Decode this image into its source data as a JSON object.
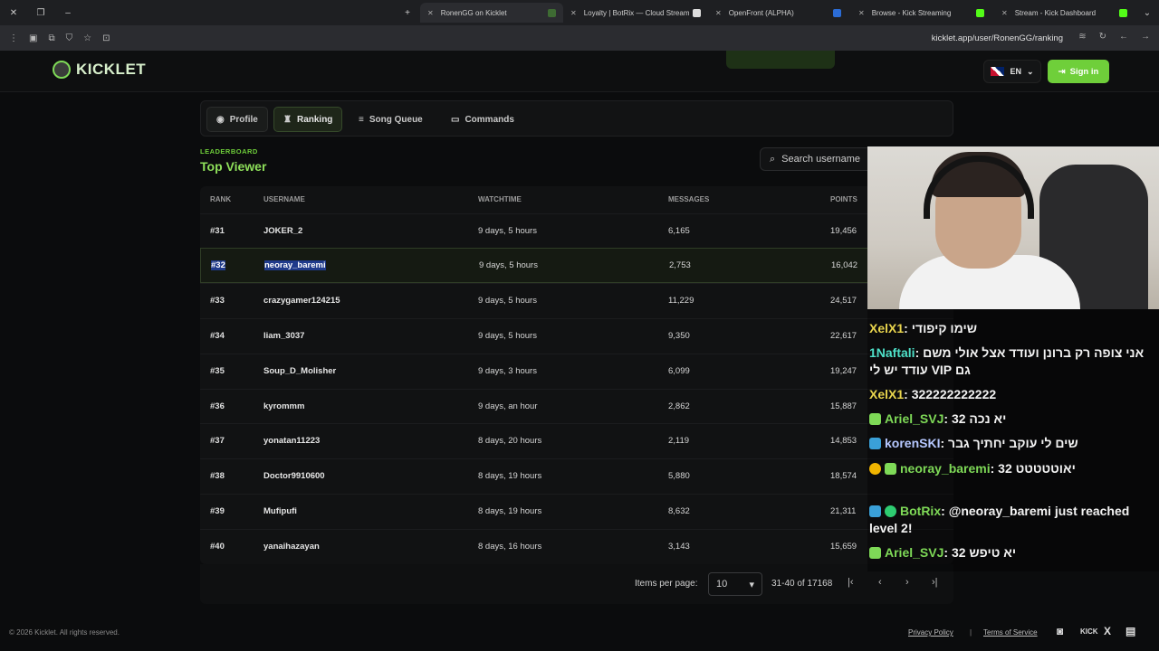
{
  "browser": {
    "tabs": [
      {
        "title": "RonenGG on Kicklet",
        "active": true
      },
      {
        "title": "Loyalty | BotRix — Cloud Stream",
        "active": false
      },
      {
        "title": "OpenFront (ALPHA)",
        "active": false
      },
      {
        "title": "Browse - Kick Streaming",
        "active": false
      },
      {
        "title": "Stream - Kick Dashboard",
        "active": false
      }
    ],
    "url": "kicklet.app/user/RonenGG/ranking"
  },
  "header": {
    "logo_text": "KICKLET",
    "language": "EN",
    "signin_label": "Sign in",
    "accent": "#6fcf3a"
  },
  "nav": {
    "items": [
      {
        "label": "Profile",
        "icon": "user-circle-icon"
      },
      {
        "label": "Ranking",
        "icon": "trophy-icon"
      },
      {
        "label": "Song Queue",
        "icon": "music-list-icon"
      },
      {
        "label": "Commands",
        "icon": "terminal-icon"
      }
    ]
  },
  "leaderboard": {
    "label": "LEADERBOARD",
    "title": "Top Viewer",
    "search_placeholder": "Search username",
    "columns": [
      "RANK",
      "USERNAME",
      "WATCHTIME",
      "MESSAGES",
      "POINTS"
    ],
    "rows": [
      {
        "rank": "#31",
        "username": "JOKER_2",
        "watchtime": "9 days, 5 hours",
        "messages": "6,165",
        "points": "19,456"
      },
      {
        "rank": "#32",
        "username": "neoray_baremi",
        "watchtime": "9 days, 5 hours",
        "messages": "2,753",
        "points": "16,042"
      },
      {
        "rank": "#33",
        "username": "crazygamer124215",
        "watchtime": "9 days, 5 hours",
        "messages": "11,229",
        "points": "24,517"
      },
      {
        "rank": "#34",
        "username": "liam_3037",
        "watchtime": "9 days, 5 hours",
        "messages": "9,350",
        "points": "22,617"
      },
      {
        "rank": "#35",
        "username": "Soup_D_Molisher",
        "watchtime": "9 days, 3 hours",
        "messages": "6,099",
        "points": "19,247"
      },
      {
        "rank": "#36",
        "username": "kyrommm",
        "watchtime": "9 days, an hour",
        "messages": "2,862",
        "points": "15,887"
      },
      {
        "rank": "#37",
        "username": "yonatan11223",
        "watchtime": "8 days, 20 hours",
        "messages": "2,119",
        "points": "14,853"
      },
      {
        "rank": "#38",
        "username": "Doctor9910600",
        "watchtime": "8 days, 19 hours",
        "messages": "5,880",
        "points": "18,574"
      },
      {
        "rank": "#39",
        "username": "Mufipufi",
        "watchtime": "8 days, 19 hours",
        "messages": "8,632",
        "points": "21,311"
      },
      {
        "rank": "#40",
        "username": "yanaihazayan",
        "watchtime": "8 days, 16 hours",
        "messages": "3,143",
        "points": "15,659"
      }
    ]
  },
  "pagination": {
    "items_per_page_label": "Items per page:",
    "items_per_page": "10",
    "range": "31-40 of 17168"
  },
  "footer": {
    "copyright": "© 2026 Kicklet. All rights reserved.",
    "privacy": "Privacy Policy",
    "separator": "|",
    "terms": "Terms of Service",
    "kick_label": "KICK",
    "x_label": "X"
  },
  "chat": {
    "messages": [
      {
        "user": "XelX1",
        "color": "#e8d44d",
        "text": "שימו קיפודי"
      },
      {
        "user": "1Naftali",
        "color": "#4ee0c8",
        "text": "אני צופה רק ברונן ועודד אצל אולי משם גם VIP עודד יש לי"
      },
      {
        "user": "XelX1",
        "color": "#e8d44d",
        "text": "322222222222"
      },
      {
        "user": "Ariel_SVJ",
        "color": "#7ed957",
        "text": "יא נכה 32"
      },
      {
        "user": "korenSKI",
        "color": "#b6c8ff",
        "text": "שים לי עוקב יחתיך גבר"
      },
      {
        "user": "neoray_baremi",
        "color": "#7ed957",
        "text": "32 יאוטטטטט"
      },
      {
        "user": "BotRix",
        "color": "#7ed957",
        "text": "@neoray_baremi just reached level 2!"
      },
      {
        "user": "Ariel_SVJ",
        "color": "#7ed957",
        "text": "יא טיפש 32"
      }
    ]
  }
}
